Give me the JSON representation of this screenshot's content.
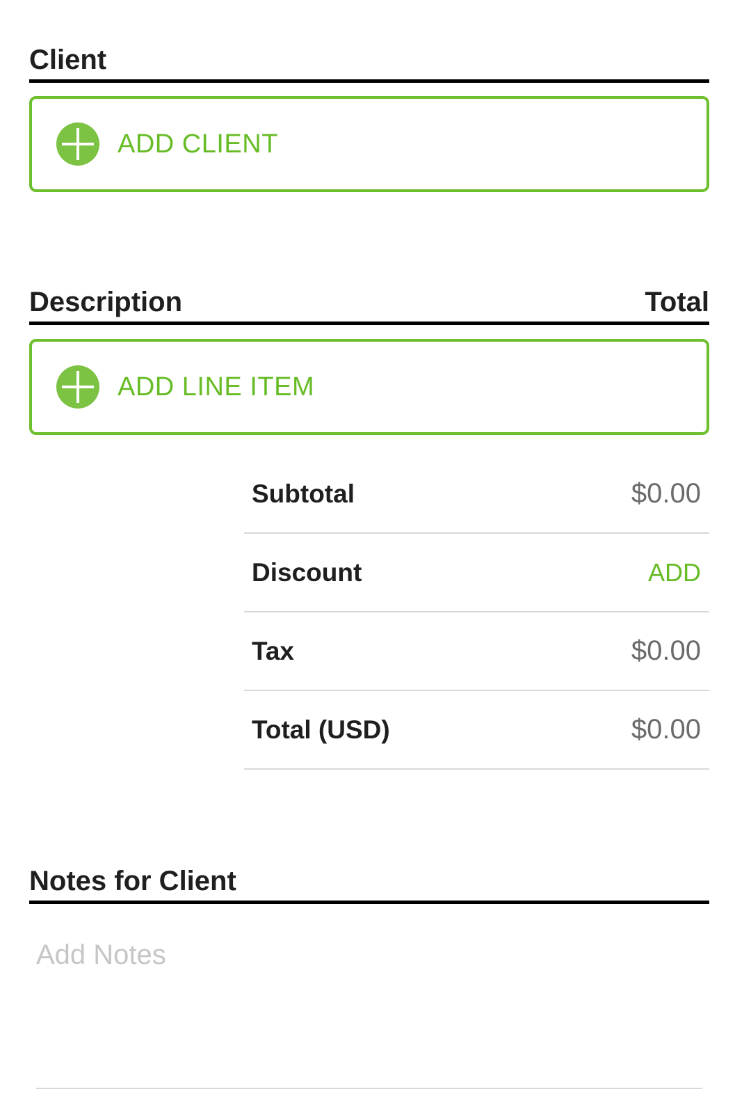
{
  "client_section": {
    "title": "Client",
    "add_label": "ADD CLIENT"
  },
  "items_section": {
    "description_header": "Description",
    "total_header": "Total",
    "add_label": "ADD LINE ITEM"
  },
  "summary": {
    "subtotal_label": "Subtotal",
    "subtotal_value": "$0.00",
    "discount_label": "Discount",
    "discount_action": "ADD",
    "tax_label": "Tax",
    "tax_value": "$0.00",
    "total_label": "Total (USD)",
    "total_value": "$0.00"
  },
  "notes_section": {
    "title": "Notes for Client",
    "placeholder": "Add Notes"
  },
  "colors": {
    "accent": "#67bc26",
    "icon_fill": "#7cc243",
    "divider": "#000000"
  },
  "icons": {
    "add": "plus-circle-icon"
  }
}
